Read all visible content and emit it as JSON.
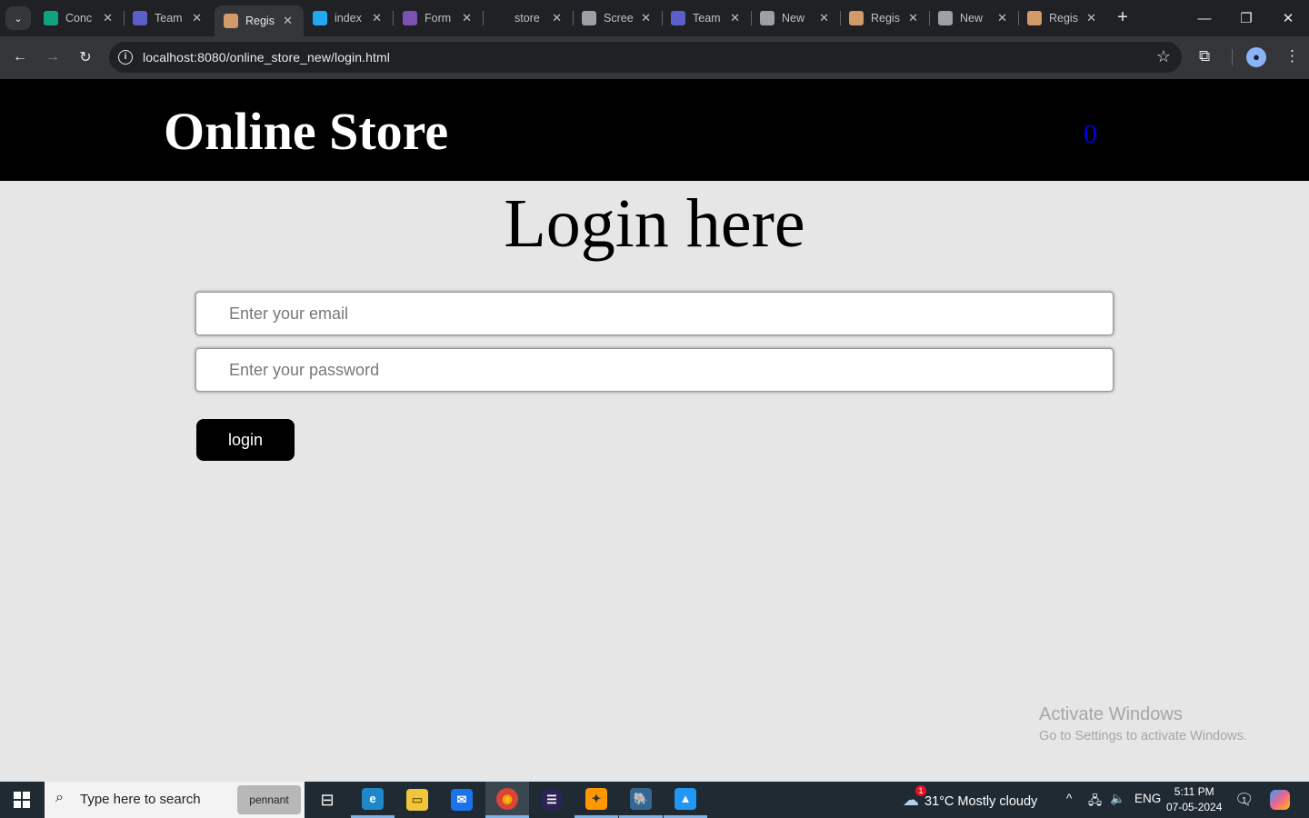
{
  "browser": {
    "tabs": [
      {
        "title": "Conc",
        "favicon": "chatgpt-icon",
        "color": "#10a37f"
      },
      {
        "title": "Team",
        "favicon": "teams-icon",
        "color": "#5b5fc7"
      },
      {
        "title": "Regis",
        "favicon": "page-icon",
        "color": "#d19a66",
        "active": true
      },
      {
        "title": "index",
        "favicon": "vscode-icon",
        "color": "#23a9f2"
      },
      {
        "title": "Form",
        "favicon": "bootstrap-icon",
        "color": "#7952b3"
      },
      {
        "title": "store",
        "favicon": "github-icon",
        "color": "#202124"
      },
      {
        "title": "Scree",
        "favicon": "globe-icon",
        "color": "#9aa0a6"
      },
      {
        "title": "Team",
        "favicon": "teams-icon",
        "color": "#5b5fc7"
      },
      {
        "title": "New",
        "favicon": "chrome-icon",
        "color": "#9aa0a6"
      },
      {
        "title": "Regis",
        "favicon": "page-icon",
        "color": "#d19a66"
      },
      {
        "title": "New",
        "favicon": "chrome-icon",
        "color": "#9aa0a6"
      },
      {
        "title": "Regis",
        "favicon": "page-icon",
        "color": "#d19a66"
      }
    ],
    "url": "localhost:8080/online_store_new/login.html"
  },
  "page": {
    "brand": "Online Store",
    "cart_count": "0",
    "heading": "Login here",
    "email_placeholder": "Enter your email",
    "password_placeholder": "Enter your password",
    "login_label": "login",
    "activate_title": "Activate Windows",
    "activate_sub": "Go to Settings to activate Windows."
  },
  "taskbar": {
    "search_placeholder": "Type here to search",
    "search_promo": "pennant",
    "weather_badge": "1",
    "weather": "31°C  Mostly cloudy",
    "lang": "ENG",
    "time": "5:11 PM",
    "date": "07-05-2024",
    "notif_count": "1"
  },
  "colors": {
    "header_bg": "#000000",
    "page_bg": "#e6e6e6",
    "cart_count": "#0000ee",
    "button_bg": "#000000"
  }
}
